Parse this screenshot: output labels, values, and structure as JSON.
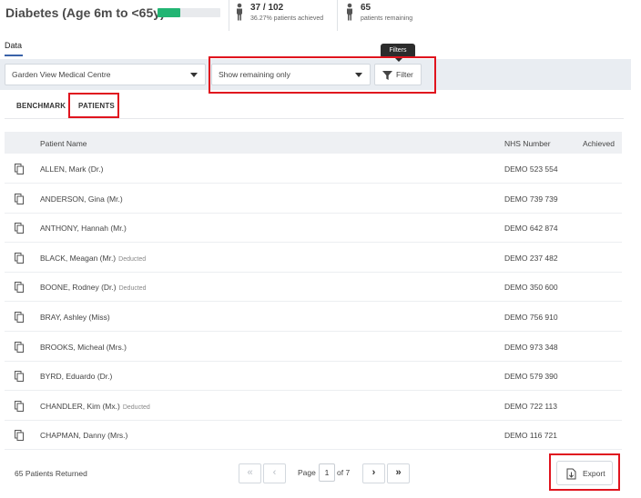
{
  "header": {
    "title": "Diabetes (Age 6m to <65y)",
    "progress_fraction": 0.3627,
    "achieved_value": "37 / 102",
    "achieved_sub": "36.27% patients achieved",
    "remaining_value": "65",
    "remaining_sub": "patients remaining",
    "progress_color": "#22b573"
  },
  "data_tab": "Data",
  "filters": {
    "practice": "Garden View Medical Centre",
    "show": "Show remaining only",
    "filter_label": "Filter",
    "tooltip": "Filters"
  },
  "subtabs": [
    "BENCHMARK",
    "PATIENTS"
  ],
  "table": {
    "columns": [
      "Patient Name",
      "NHS Number",
      "Achieved"
    ],
    "rows": [
      {
        "name": "ALLEN, Mark (Dr.)",
        "tag": "",
        "nhs": "DEMO 523 554"
      },
      {
        "name": "ANDERSON, Gina (Mr.)",
        "tag": "",
        "nhs": "DEMO 739 739"
      },
      {
        "name": "ANTHONY, Hannah (Mr.)",
        "tag": "",
        "nhs": "DEMO 642 874"
      },
      {
        "name": "BLACK, Meagan (Mr.)",
        "tag": "Deducted",
        "nhs": "DEMO 237 482"
      },
      {
        "name": "BOONE, Rodney (Dr.)",
        "tag": "Deducted",
        "nhs": "DEMO 350 600"
      },
      {
        "name": "BRAY, Ashley (Miss)",
        "tag": "",
        "nhs": "DEMO 756 910"
      },
      {
        "name": "BROOKS, Micheal (Mrs.)",
        "tag": "",
        "nhs": "DEMO 973 348"
      },
      {
        "name": "BYRD, Eduardo (Dr.)",
        "tag": "",
        "nhs": "DEMO 579 390"
      },
      {
        "name": "CHANDLER, Kim (Mx.)",
        "tag": "Deducted",
        "nhs": "DEMO 722 113"
      },
      {
        "name": "CHAPMAN, Danny (Mrs.)",
        "tag": "",
        "nhs": "DEMO 116 721"
      }
    ]
  },
  "footer": {
    "returned": "65 Patients Returned",
    "page_label": "Page",
    "page_value": "1",
    "of_label": "of 7",
    "export_label": "Export"
  },
  "icons": {
    "person": "person-icon",
    "copy": "copy-icon",
    "funnel": "funnel-icon",
    "export": "export-icon"
  },
  "colors": {
    "annotation": "#e0141e",
    "accent": "#3a62a8"
  }
}
